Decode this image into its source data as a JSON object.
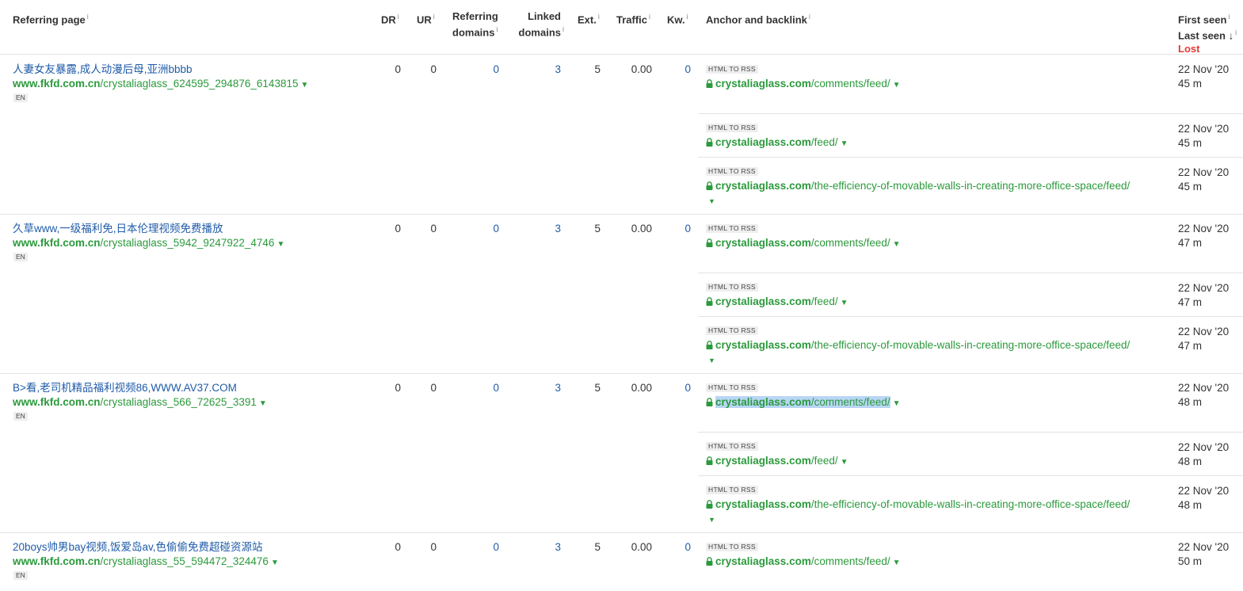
{
  "headers": {
    "referring_page": "Referring page",
    "dr": "DR",
    "ur": "UR",
    "referring_domains_1": "Referring",
    "referring_domains_2": "domains",
    "linked_domains_1": "Linked",
    "linked_domains_2": "domains",
    "ext": "Ext.",
    "traffic": "Traffic",
    "kw": "Kw.",
    "anchor": "Anchor and backlink",
    "first_seen": "First seen",
    "last_seen": "Last seen",
    "lost": "Lost",
    "info": "i",
    "sort_arrow": "↓"
  },
  "rows": [
    {
      "title": "人妻女友暴露,成人动漫后母,亚洲bbbb",
      "domain": "www.fkfd.com.cn",
      "path": "/crystaliaglass_624595_294876_6143815",
      "lang": "EN",
      "dr": "0",
      "ur": "0",
      "ref_domains": "0",
      "linked_domains": "3",
      "ext": "5",
      "traffic": "0.00",
      "kw": "0",
      "backlinks": [
        {
          "tag": "HTML TO RSS",
          "domain": "crystaliaglass.com",
          "path": "/comments/feed/",
          "date1": "22 Nov '20",
          "date2": "45 m"
        },
        {
          "tag": "HTML TO RSS",
          "domain": "crystaliaglass.com",
          "path": "/feed/",
          "date1": "22 Nov '20",
          "date2": "45 m"
        },
        {
          "tag": "HTML TO RSS",
          "domain": "crystaliaglass.com",
          "path": "/the-efficiency-of-movable-walls-in-creating-more-office-space/feed/",
          "date1": "22 Nov '20",
          "date2": "45 m"
        }
      ]
    },
    {
      "title": "久草www,一级福利免,日本伦理视频免费播放",
      "domain": "www.fkfd.com.cn",
      "path": "/crystaliaglass_5942_9247922_4746",
      "lang": "EN",
      "dr": "0",
      "ur": "0",
      "ref_domains": "0",
      "linked_domains": "3",
      "ext": "5",
      "traffic": "0.00",
      "kw": "0",
      "backlinks": [
        {
          "tag": "HTML TO RSS",
          "domain": "crystaliaglass.com",
          "path": "/comments/feed/",
          "date1": "22 Nov '20",
          "date2": "47 m"
        },
        {
          "tag": "HTML TO RSS",
          "domain": "crystaliaglass.com",
          "path": "/feed/",
          "date1": "22 Nov '20",
          "date2": "47 m"
        },
        {
          "tag": "HTML TO RSS",
          "domain": "crystaliaglass.com",
          "path": "/the-efficiency-of-movable-walls-in-creating-more-office-space/feed/",
          "date1": "22 Nov '20",
          "date2": "47 m"
        }
      ]
    },
    {
      "title": "B>看,老司机精品福利视频86,WWW.AV37.COM",
      "domain": "www.fkfd.com.cn",
      "path": "/crystaliaglass_566_72625_3391",
      "lang": "EN",
      "dr": "0",
      "ur": "0",
      "ref_domains": "0",
      "linked_domains": "3",
      "ext": "5",
      "traffic": "0.00",
      "kw": "0",
      "backlinks": [
        {
          "tag": "HTML TO RSS",
          "domain": "crystaliaglass.com",
          "path": "/comments/feed/",
          "date1": "22 Nov '20",
          "date2": "48 m"
        },
        {
          "tag": "HTML TO RSS",
          "domain": "crystaliaglass.com",
          "path": "/feed/",
          "date1": "22 Nov '20",
          "date2": "48 m"
        },
        {
          "tag": "HTML TO RSS",
          "domain": "crystaliaglass.com",
          "path": "/the-efficiency-of-movable-walls-in-creating-more-office-space/feed/",
          "date1": "22 Nov '20",
          "date2": "48 m"
        }
      ]
    },
    {
      "title": "20boys帅男bay视频,饭爱岛av,色偷偷免费超碰资源站",
      "domain": "www.fkfd.com.cn",
      "path": "/crystaliaglass_55_594472_324476",
      "lang": "EN",
      "dr": "0",
      "ur": "0",
      "ref_domains": "0",
      "linked_domains": "3",
      "ext": "5",
      "traffic": "0.00",
      "kw": "0",
      "backlinks": [
        {
          "tag": "HTML TO RSS",
          "domain": "crystaliaglass.com",
          "path": "/comments/feed/",
          "date1": "22 Nov '20",
          "date2": "50 m"
        }
      ]
    }
  ],
  "icons": {
    "lock": "lock-icon",
    "caret": "caret-down-icon"
  },
  "colors": {
    "link_blue": "#1f5ba8",
    "url_green": "#2b9a3c",
    "lost_red": "#e53935",
    "selection": "#b9d6f5"
  }
}
